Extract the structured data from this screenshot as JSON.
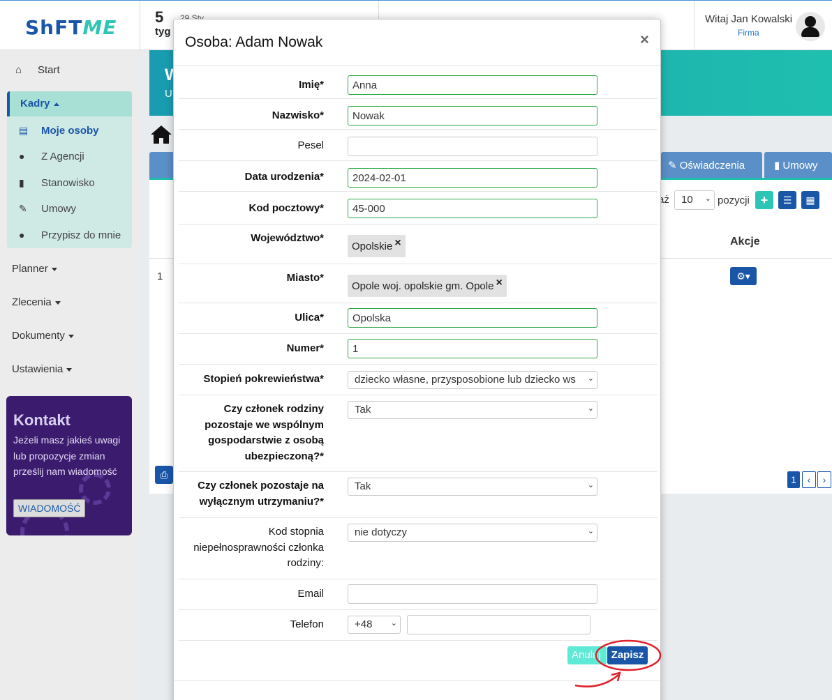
{
  "app": {
    "logo_main": "ShFT",
    "logo_accent": "ME",
    "week_number": "5",
    "week_label": "tyg",
    "week_date": "29 Sty",
    "greeting": "Witaj Jan Kowalski",
    "company": "Firma"
  },
  "sidebar": {
    "start": "Start",
    "kadry": "Kadry",
    "kadry_items": [
      "Moje osoby",
      "Z Agencji",
      "Stanowisko",
      "Umowy",
      "Przypisz do mnie"
    ],
    "menus": [
      "Planner",
      "Zlecenia",
      "Dokumenty",
      "Ustawienia"
    ],
    "kontakt_title": "Kontakt",
    "kontakt_text": "Jeżeli masz jakieś uwagi lub propozycje zmian prześlij nam wiadomość",
    "kontakt_button": "WIADOMOŚĆ"
  },
  "main": {
    "banner_letter": "W",
    "banner_sub": "U",
    "tabs": [
      "Oświadczenia",
      "Umowy"
    ],
    "show_suffix": "aż",
    "page_size": "10",
    "pozycji": "pozycji",
    "akcje": "Akcje",
    "row_number": "1",
    "current_page": "1"
  },
  "modal": {
    "title": "Osoba: Adam Nowak",
    "close": "×",
    "fields": {
      "imie": {
        "label": "Imię*",
        "value": "Anna"
      },
      "nazwisko": {
        "label": "Nazwisko*",
        "value": "Nowak"
      },
      "pesel": {
        "label": "Pesel",
        "value": ""
      },
      "data_urodzenia": {
        "label": "Data urodzenia*",
        "value": "2024-02-01"
      },
      "kod_pocztowy": {
        "label": "Kod pocztowy*",
        "value": "45-000"
      },
      "wojewodztwo": {
        "label": "Województwo*",
        "value": "Opolskie"
      },
      "miasto": {
        "label": "Miasto*",
        "value": "Opole woj. opolskie gm. Opole"
      },
      "ulica": {
        "label": "Ulica*",
        "value": "Opolska"
      },
      "numer": {
        "label": "Numer*",
        "value": "1"
      },
      "stopien": {
        "label": "Stopień pokrewieństwa*",
        "value": "dziecko własne, przysposobione lub dziecko ws"
      },
      "wspolne_gosp": {
        "label": "Czy członek rodziny pozostaje we wspólnym gospodarstwie z osobą ubezpieczoną?*",
        "value": "Tak"
      },
      "utrzymanie": {
        "label": "Czy członek pozostaje na wyłącznym utrzymaniu?*",
        "value": "Tak"
      },
      "niepelnosprawnosc": {
        "label": "Kod stopnia niepełnosprawności członka rodziny:",
        "value": "nie dotyczy"
      },
      "email": {
        "label": "Email",
        "value": ""
      },
      "telefon": {
        "label": "Telefon",
        "prefix": "+48",
        "value": ""
      }
    },
    "cancel_button": "Anuluj",
    "save_button": "Zapisz"
  },
  "colors": {
    "primary": "#1a56a8",
    "accent": "#1fbfaf",
    "valid_border": "#28a745",
    "annotation": "#e0202a"
  }
}
